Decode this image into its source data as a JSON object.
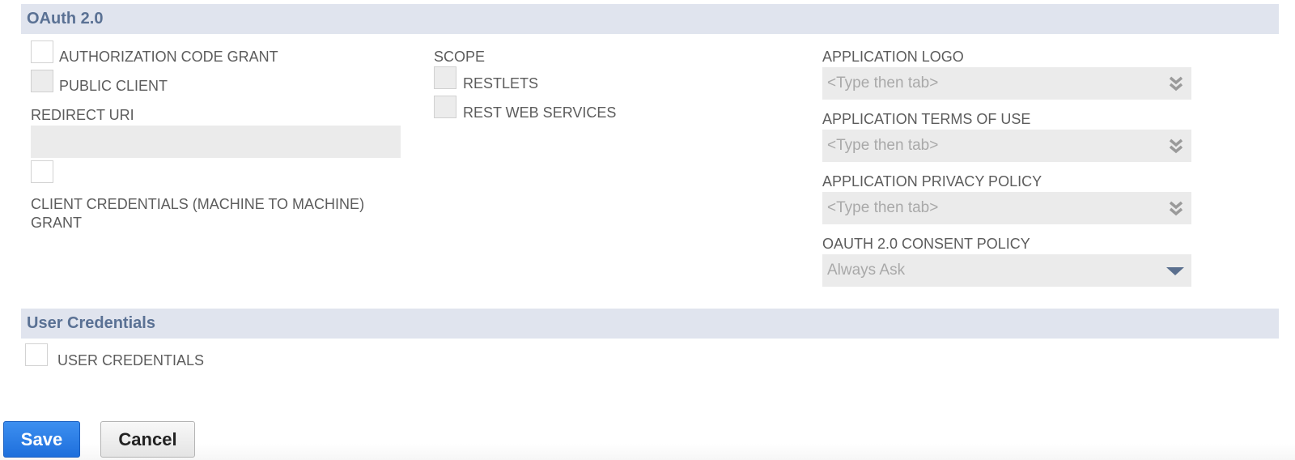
{
  "sections": {
    "oauth": {
      "title": "OAuth 2.0"
    },
    "user_credentials": {
      "title": "User Credentials"
    }
  },
  "oauth": {
    "authorization_code_grant": {
      "label": "AUTHORIZATION CODE GRANT",
      "checked": false,
      "disabled": false
    },
    "public_client": {
      "label": "PUBLIC CLIENT",
      "checked": false,
      "disabled": true
    },
    "redirect_uri": {
      "label": "REDIRECT URI",
      "value": ""
    },
    "client_credentials_grant": {
      "label": "CLIENT CREDENTIALS (MACHINE TO MACHINE) GRANT",
      "checked": false,
      "disabled": false
    },
    "scope": {
      "label": "SCOPE",
      "options": [
        {
          "label": "RESTLETS",
          "checked": false,
          "disabled": true
        },
        {
          "label": "REST WEB SERVICES",
          "checked": false,
          "disabled": true
        }
      ]
    },
    "application_logo": {
      "label": "APPLICATION LOGO",
      "placeholder": "<Type then tab>",
      "icon": "double-chevron-down-icon"
    },
    "application_terms_of_use": {
      "label": "APPLICATION TERMS OF USE",
      "placeholder": "<Type then tab>",
      "icon": "double-chevron-down-icon"
    },
    "application_privacy_policy": {
      "label": "APPLICATION PRIVACY POLICY",
      "placeholder": "<Type then tab>",
      "icon": "double-chevron-down-icon"
    },
    "consent_policy": {
      "label": "OAUTH 2.0 CONSENT POLICY",
      "value": "Always Ask",
      "icon": "caret-down-icon"
    }
  },
  "user_credentials": {
    "checkbox": {
      "label": "USER CREDENTIALS",
      "checked": false,
      "disabled": false
    }
  },
  "actions": {
    "save_label": "Save",
    "cancel_label": "Cancel"
  },
  "colors": {
    "section_header_bg": "#e0e4ee",
    "section_header_text": "#5a7194",
    "save_button": "#2a7ee6",
    "field_bg": "#ebebeb"
  }
}
